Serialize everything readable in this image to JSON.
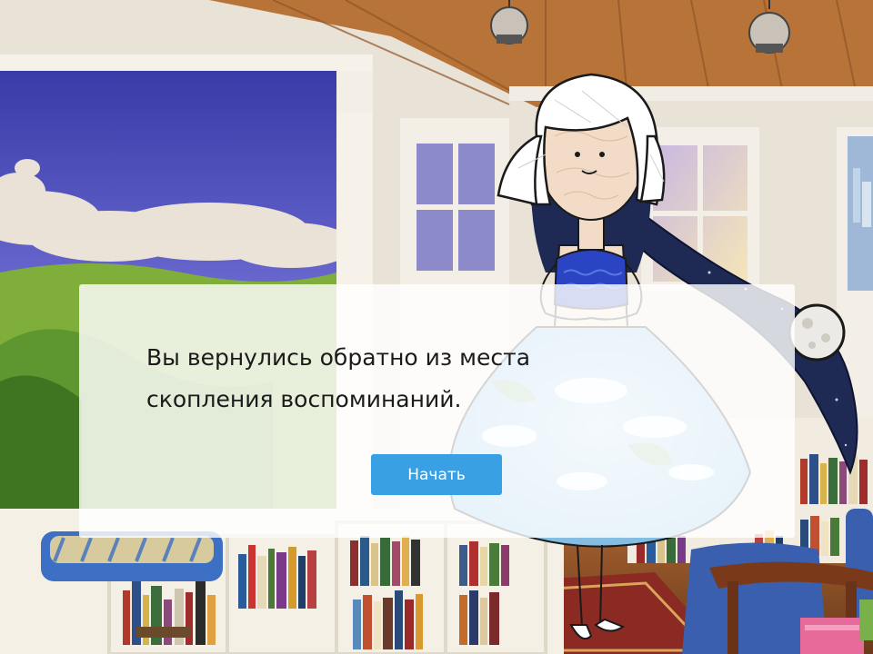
{
  "dialog": {
    "message": "Вы вернулись обратно из места\nскопления воспоминаний.",
    "start_label": "Начать"
  },
  "theme": {
    "button_color": "#3aa0e4",
    "dialog_background": "rgba(255,255,255,0.82)"
  }
}
